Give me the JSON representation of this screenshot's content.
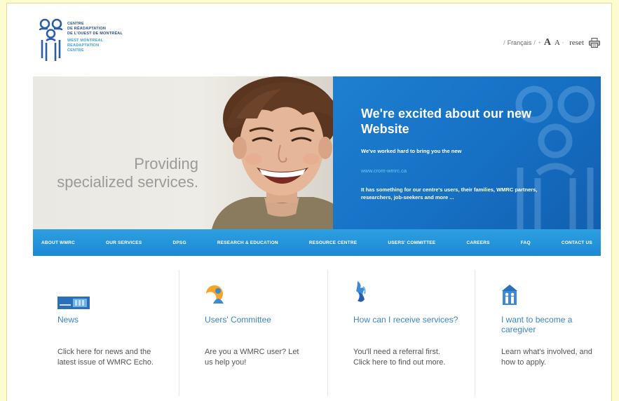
{
  "logo": {
    "fr_lines": [
      "CENTRE",
      "DE RÉADAPTATION",
      "DE L'OUEST DE MONTRÉAL"
    ],
    "en_lines": [
      "WEST MONTREAL",
      "READAPTATION",
      "CENTRE"
    ]
  },
  "utility": {
    "language": "Français",
    "text_larger": "A",
    "text_smaller": "A",
    "reset": "reset",
    "print_icon": "printer-icon"
  },
  "hero": {
    "tagline_line1": "Providing",
    "tagline_line2": "specialized services.",
    "heading": "We're excited about our new Website",
    "paragraph1": "We've worked hard to bring you the new",
    "link": "www.crom-wmrc.ca",
    "paragraph2": "It has something for our centre's users, their families, WMRC partners, researchers, job-seekers and more ...",
    "colors": {
      "panel": "#1a78c8",
      "link": "#6fc8f5"
    }
  },
  "nav": {
    "items": [
      "ABOUT WMRC",
      "OUR SERVICES",
      "DPSG",
      "RESEARCH & EDUCATION",
      "RESOURCE CENTRE",
      "USERS' COMMITTEE",
      "CAREERS",
      "FAQ",
      "CONTACT US"
    ],
    "color": "#1f8fd8"
  },
  "tiles": [
    {
      "icon": "newsletter-icon",
      "title": "News",
      "text": "Click here for news and the latest issue of WMRC Echo."
    },
    {
      "icon": "users-committee-icon",
      "title": "Users' Committee",
      "text": "Are you a WMRC user? Let us help you!"
    },
    {
      "icon": "hands-icon",
      "title": "How can I receive services?",
      "text": "You'll need a referral first. Click here to find out more."
    },
    {
      "icon": "caregiver-house-icon",
      "title": "I want to become a caregiver",
      "text": "Learn what's involved, and how to apply."
    }
  ]
}
